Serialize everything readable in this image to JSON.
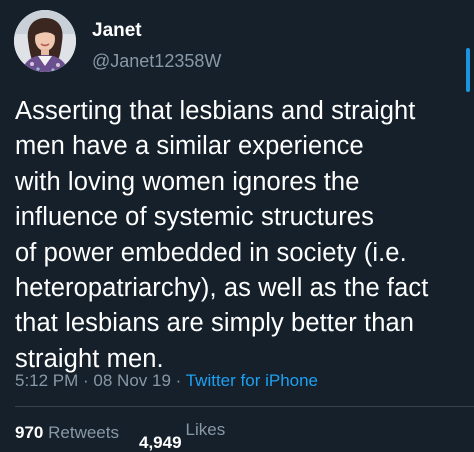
{
  "user": {
    "display_name": "Janet",
    "handle": "@Janet12358W",
    "avatar_icon": "profile-photo"
  },
  "tweet": {
    "text_lines": [
      "Asserting that lesbians and straight",
      "men have a similar experience",
      "with loving women ignores the",
      "influence of systemic structures",
      "of power embedded in society (i.e.",
      "heteropatriarchy), as well as the fact",
      "that lesbians are simply better than",
      "straight men."
    ],
    "time": "5:12 PM",
    "separator": " · ",
    "date": "08 Nov 19",
    "source": "Twitter for iPhone"
  },
  "stats": {
    "retweets_count": "970",
    "retweets_label": "Retweets",
    "likes_count": "4,949",
    "likes_label": "Likes"
  },
  "colors": {
    "background": "#15202b",
    "text": "#ffffff",
    "muted": "#8899a6",
    "link": "#1da1f2",
    "divider": "#38444d"
  }
}
